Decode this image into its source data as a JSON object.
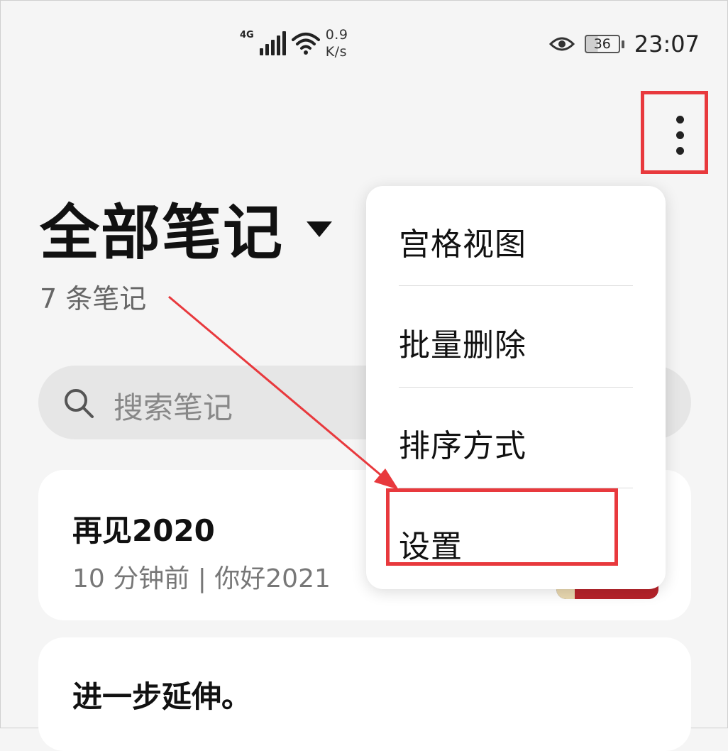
{
  "status_bar": {
    "network": "4G",
    "speed_value": "0.9",
    "speed_unit": "K/s",
    "battery": "36",
    "time": "23:07"
  },
  "header": {
    "more_icon": "more-vertical-icon",
    "title": "全部笔记",
    "note_count": "7 条笔记"
  },
  "search": {
    "placeholder": "搜索笔记",
    "icon": "search-icon"
  },
  "notes": [
    {
      "title": "再见2020",
      "meta": "10 分钟前 | 你好2021"
    },
    {
      "title": "进一步延伸。"
    }
  ],
  "menu": {
    "items": [
      {
        "label": "宫格视图"
      },
      {
        "label": "批量删除"
      },
      {
        "label": "排序方式"
      },
      {
        "label": "设置"
      }
    ]
  },
  "annotation": {
    "color": "#e8393d"
  }
}
